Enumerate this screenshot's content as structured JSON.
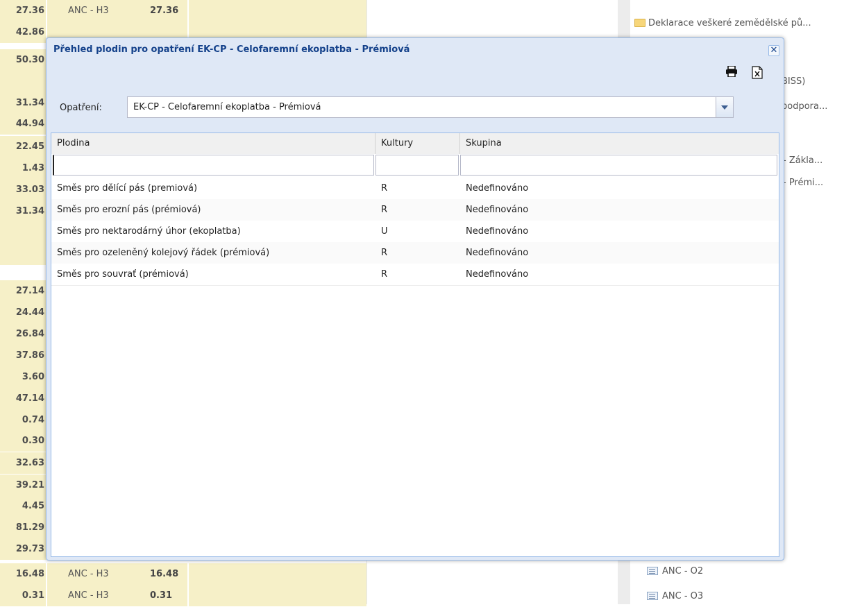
{
  "background": {
    "rows": [
      {
        "value": "27.36",
        "anc": "ANC - H3",
        "num": "27.36"
      },
      {
        "value": "42.86",
        "anc": "",
        "num": ""
      },
      {
        "value": "50.30",
        "anc": "",
        "num": ""
      },
      {
        "value": "",
        "anc": "",
        "num": ""
      },
      {
        "value": "31.34",
        "anc": "",
        "num": ""
      },
      {
        "value": "44.94",
        "anc": "",
        "num": ""
      },
      {
        "value": "22.45",
        "anc": "",
        "num": ""
      },
      {
        "value": "1.43",
        "anc": "",
        "num": ""
      },
      {
        "value": "33.03",
        "anc": "",
        "num": ""
      },
      {
        "value": "31.34",
        "anc": "",
        "num": ""
      },
      {
        "value": "",
        "anc": "",
        "num": ""
      },
      {
        "value": "",
        "anc": "",
        "num": ""
      },
      {
        "value": "27.14",
        "anc": "",
        "num": ""
      },
      {
        "value": "24.44",
        "anc": "",
        "num": ""
      },
      {
        "value": "26.84",
        "anc": "",
        "num": ""
      },
      {
        "value": "37.86",
        "anc": "",
        "num": ""
      },
      {
        "value": "3.60",
        "anc": "",
        "num": ""
      },
      {
        "value": "47.14",
        "anc": "",
        "num": ""
      },
      {
        "value": "0.74",
        "anc": "",
        "num": ""
      },
      {
        "value": "0.30",
        "anc": "",
        "num": ""
      },
      {
        "value": "32.63",
        "anc": "",
        "num": ""
      },
      {
        "value": "39.21",
        "anc": "",
        "num": ""
      },
      {
        "value": "4.45",
        "anc": "",
        "num": ""
      },
      {
        "value": "81.29",
        "anc": "",
        "num": ""
      },
      {
        "value": "29.73",
        "anc": "",
        "num": ""
      },
      {
        "value": "16.48",
        "anc": "ANC - H3",
        "num": "16.48"
      },
      {
        "value": "0.31",
        "anc": "ANC - H3",
        "num": "0.31"
      }
    ]
  },
  "tree": {
    "folder_label": "Deklarace veškeré zemědělské pů...",
    "partial_1": "BISS)",
    "partial_2": "podpora...",
    "partial_3": "- Zákla...",
    "partial_4": "- Prémi...",
    "item_o2": "ANC - O2",
    "item_o3": "ANC - O3"
  },
  "modal": {
    "title": "Přehled plodin pro opatření EK-CP - Celofaremní ekoplatba - Prémiová",
    "close_glyph": "✕",
    "filter_label": "Opatření:",
    "filter_value": "EK-CP - Celofaremní ekoplatba - Prémiová",
    "columns": {
      "plodina": "Plodina",
      "kultury": "Kultury",
      "skupina": "Skupina"
    },
    "rows": [
      {
        "plodina": "Směs pro dělící pás (premiová)",
        "kultury": "R",
        "skupina": "Nedefinováno"
      },
      {
        "plodina": "Směs pro erozní pás (prémiová)",
        "kultury": "R",
        "skupina": "Nedefinováno"
      },
      {
        "plodina": "Směs pro nektarodárný úhor (ekoplatba)",
        "kultury": "U",
        "skupina": "Nedefinováno"
      },
      {
        "plodina": "Směs pro ozeleněný kolejový řádek (prémiová)",
        "kultury": "R",
        "skupina": "Nedefinováno"
      },
      {
        "plodina": "Směs pro souvrať (prémiová)",
        "kultury": "R",
        "skupina": "Nedefinováno"
      }
    ]
  },
  "colors": {
    "title": "#15428b",
    "modal_bg": "#dfe8f6",
    "row_highlight": "#f6f0c8"
  }
}
